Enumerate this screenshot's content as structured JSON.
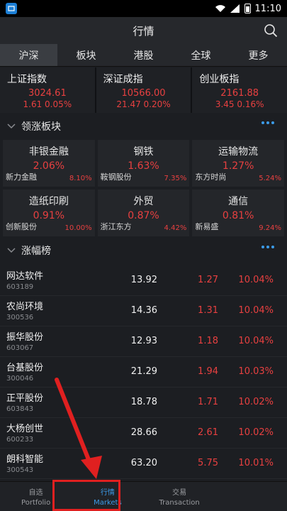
{
  "status": {
    "time": "11:10"
  },
  "header": {
    "title": "行情"
  },
  "tabs": [
    {
      "label": "沪深",
      "active": true
    },
    {
      "label": "板块",
      "active": false
    },
    {
      "label": "港股",
      "active": false
    },
    {
      "label": "全球",
      "active": false
    },
    {
      "label": "更多",
      "active": false
    }
  ],
  "indices": [
    {
      "name": "上证指数",
      "value": "3024.61",
      "change": "1.61  0.05%"
    },
    {
      "name": "深证成指",
      "value": "10566.00",
      "change": "21.47  0.20%"
    },
    {
      "name": "创业板指",
      "value": "2161.88",
      "change": "3.45  0.16%"
    }
  ],
  "sectors_section": {
    "title": "领涨板块"
  },
  "sectors": [
    {
      "name": "非银金融",
      "pct": "2.06%",
      "stock": "新力金融",
      "stock_pct": "8.10%"
    },
    {
      "name": "钢铁",
      "pct": "1.63%",
      "stock": "鞍钢股份",
      "stock_pct": "7.35%"
    },
    {
      "name": "运输物流",
      "pct": "1.27%",
      "stock": "东方时尚",
      "stock_pct": "5.24%"
    },
    {
      "name": "造纸印刷",
      "pct": "0.91%",
      "stock": "创新股份",
      "stock_pct": "10.00%"
    },
    {
      "name": "外贸",
      "pct": "0.87%",
      "stock": "浙江东方",
      "stock_pct": "4.42%"
    },
    {
      "name": "通信",
      "pct": "0.81%",
      "stock": "新易盛",
      "stock_pct": "9.24%"
    }
  ],
  "gainers_section": {
    "title": "涨幅榜"
  },
  "stocks": [
    {
      "name": "网达软件",
      "code": "603189",
      "price": "13.92",
      "change": "1.27",
      "pct": "10.04%"
    },
    {
      "name": "农尚环境",
      "code": "300536",
      "price": "14.36",
      "change": "1.31",
      "pct": "10.04%"
    },
    {
      "name": "振华股份",
      "code": "603067",
      "price": "12.93",
      "change": "1.18",
      "pct": "10.04%"
    },
    {
      "name": "台基股份",
      "code": "300046",
      "price": "21.29",
      "change": "1.94",
      "pct": "10.03%"
    },
    {
      "name": "正平股份",
      "code": "603843",
      "price": "18.78",
      "change": "1.71",
      "pct": "10.02%"
    },
    {
      "name": "大杨创世",
      "code": "600233",
      "price": "28.66",
      "change": "2.61",
      "pct": "10.02%"
    },
    {
      "name": "朗科智能",
      "code": "300543",
      "price": "63.20",
      "change": "5.75",
      "pct": "10.01%"
    }
  ],
  "bottom_nav": [
    {
      "zh": "自选",
      "en": "Portfolio",
      "active": false
    },
    {
      "zh": "行情",
      "en": "Markets",
      "active": true
    },
    {
      "zh": "交易",
      "en": "Transaction",
      "active": false
    },
    {
      "zh": "",
      "en": "",
      "active": false
    }
  ],
  "colors": {
    "up": "#e84040",
    "accent": "#3c9be8",
    "highlight": "#e02020"
  }
}
